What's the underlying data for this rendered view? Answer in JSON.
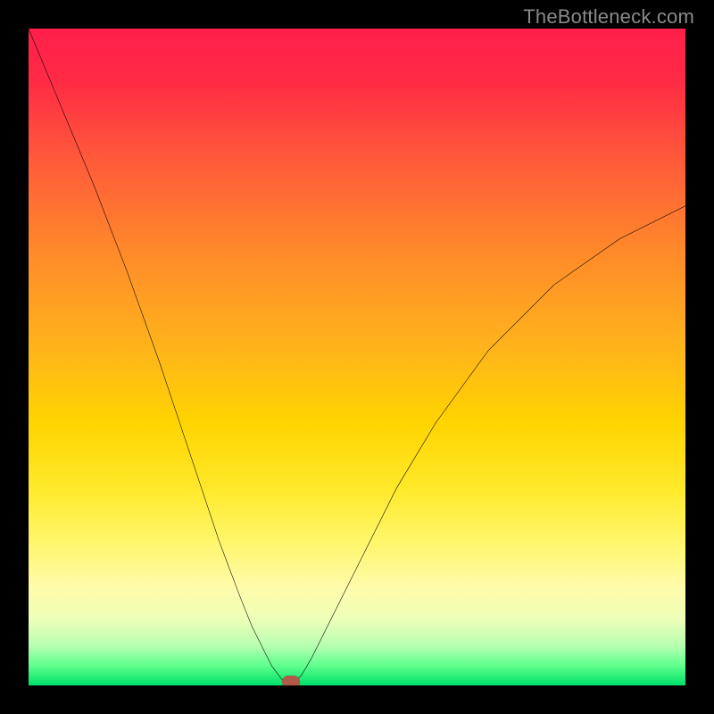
{
  "watermark": "TheBottleneck.com",
  "chart_data": {
    "type": "line",
    "title": "",
    "xlabel": "",
    "ylabel": "",
    "xlim": [
      0,
      100
    ],
    "ylim": [
      0,
      100
    ],
    "grid": false,
    "legend": false,
    "series": [
      {
        "name": "bottleneck-curve",
        "x": [
          0,
          5,
          10,
          15,
          20,
          23,
          26,
          29,
          32,
          34,
          36,
          37,
          38.5,
          39,
          39.5,
          40,
          40.5,
          41.5,
          43,
          45,
          48,
          52,
          56,
          62,
          70,
          80,
          90,
          100
        ],
        "y": [
          100,
          88,
          76,
          63,
          49,
          40,
          31,
          22,
          14,
          9,
          5,
          3,
          1,
          0.5,
          0.5,
          0.5,
          0.5,
          1.5,
          4,
          8,
          14,
          22,
          30,
          40,
          51,
          61,
          68,
          73
        ]
      }
    ],
    "marker": {
      "x": 40,
      "y": 0.5
    },
    "background_gradient": {
      "direction": "top-to-bottom",
      "stops": [
        {
          "color": "#ff1f4a",
          "pct": 0
        },
        {
          "color": "#ffd400",
          "pct": 60
        },
        {
          "color": "#00e06a",
          "pct": 100
        }
      ]
    }
  }
}
